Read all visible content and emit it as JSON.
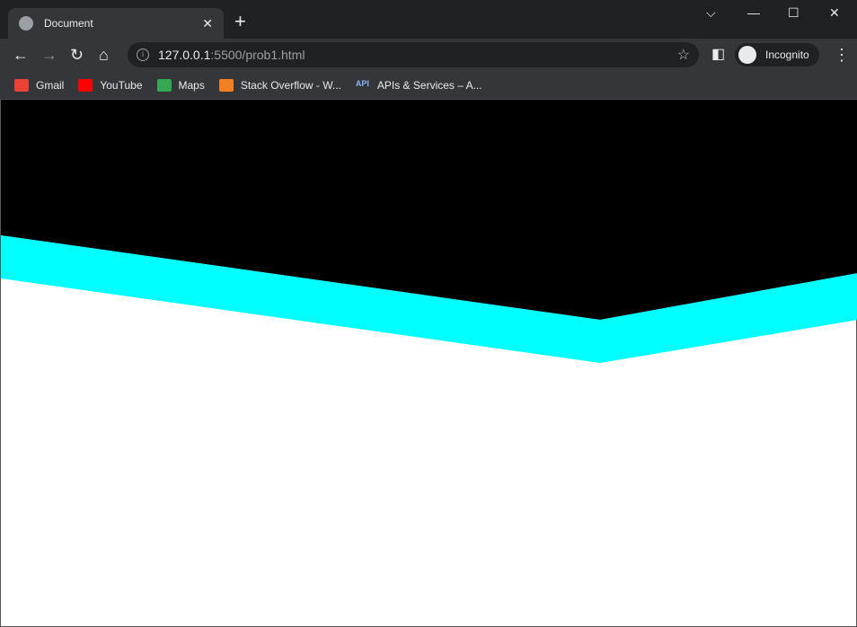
{
  "tab": {
    "title": "Document"
  },
  "address": {
    "host": "127.0.0.1",
    "path": ":5500/prob1.html"
  },
  "profile": {
    "label": "Incognito"
  },
  "bookmarks": [
    {
      "label": "Gmail",
      "color": "#ea4335"
    },
    {
      "label": "YouTube",
      "color": "#ff0000"
    },
    {
      "label": "Maps",
      "color": "#34a853"
    },
    {
      "label": "Stack Overflow - W...",
      "color": "#f48024"
    },
    {
      "label": "APIs & Services – A...",
      "color": "#8ab4f8"
    }
  ],
  "page": {
    "background": "#000000",
    "band_color": "#00ffff",
    "body_color": "#ffffff"
  }
}
